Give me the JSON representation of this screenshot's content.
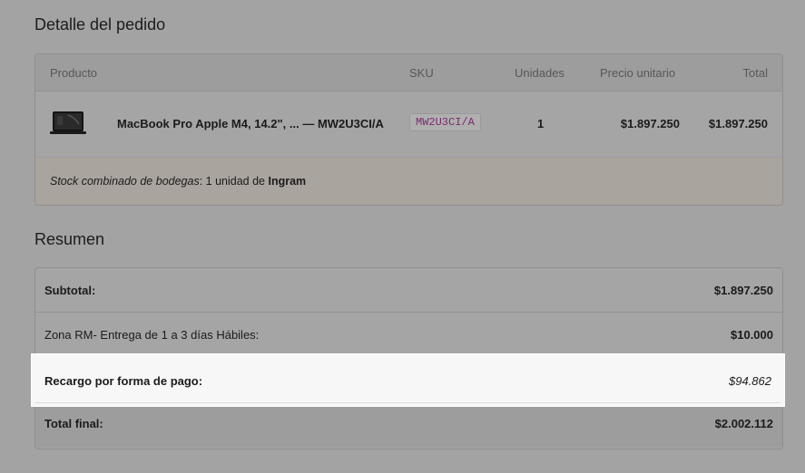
{
  "order_detail": {
    "title": "Detalle del pedido",
    "columns": {
      "producto": "Producto",
      "sku": "SKU",
      "unidades": "Unidades",
      "precio_unitario": "Precio unitario",
      "total": "Total"
    },
    "items": [
      {
        "name": "MacBook Pro Apple M4, 14.2\", ... — MW2U3CI/A",
        "sku": "MW2U3CI/A",
        "quantity": "1",
        "unit_price": "$1.897.250",
        "total": "$1.897.250",
        "thumb_icon": "laptop-icon"
      }
    ],
    "stock_note": {
      "label": "Stock combinado de bodegas",
      "value": ": 1 unidad de ",
      "supplier": "Ingram"
    }
  },
  "summary": {
    "title": "Resumen",
    "subtotal_label": "Subtotal:",
    "subtotal_value": "$1.897.250",
    "shipping_label": "Zona RM- Entrega de 1 a 3 días Hábiles:",
    "shipping_value": "$10.000",
    "surcharge_label": "Recargo por forma de pago:",
    "surcharge_value": "$94.862",
    "total_label": "Total final:",
    "total_value": "$2.002.112"
  },
  "colors": {
    "overlay": "#a3a3a3",
    "highlight": "#f7f7f7",
    "sku_text": "#7a2a6e"
  }
}
